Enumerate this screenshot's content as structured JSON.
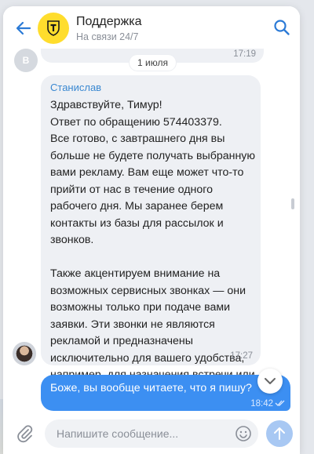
{
  "header": {
    "title": "Поддержка",
    "subtitle": "На связи 24/7"
  },
  "previous_message": {
    "avatar_letter": "В",
    "time": "17:19"
  },
  "date_separator": "1 июля",
  "message": {
    "sender": "Станислав",
    "text": "Здравствуйте, Тимур!\nОтвет по обращению 574403379.\nВсе готово, с завтрашнего дня вы больше не будете получать выбранную вами рекламу. Вам еще может что-то прийти от нас в течение одного рабочего дня. Мы заранее берем контакты из базы для рассылок и звонков.\n\nТакже акцентируем внимание на возможных сервисных звонках — они возможны только при подаче вами заявки. Эти звонки не являются рекламой и предназначены исключительно для вашего удобства, например, для назначения встречи или согласования условий.",
    "time": "17:27"
  },
  "own_message": {
    "text": "Боже, вы вообще читаете, что я пишу?",
    "time": "18:42"
  },
  "composer": {
    "placeholder": "Напишите сообщение..."
  },
  "colors": {
    "accent": "#3c8ff2",
    "logo": "#ffdd2d",
    "sender": "#3a88d1"
  },
  "icons": [
    "back-arrow-icon",
    "shield-logo-icon",
    "search-icon",
    "chevron-down-icon",
    "paperclip-icon",
    "emoji-icon",
    "send-arrow-icon",
    "double-check-icon"
  ]
}
